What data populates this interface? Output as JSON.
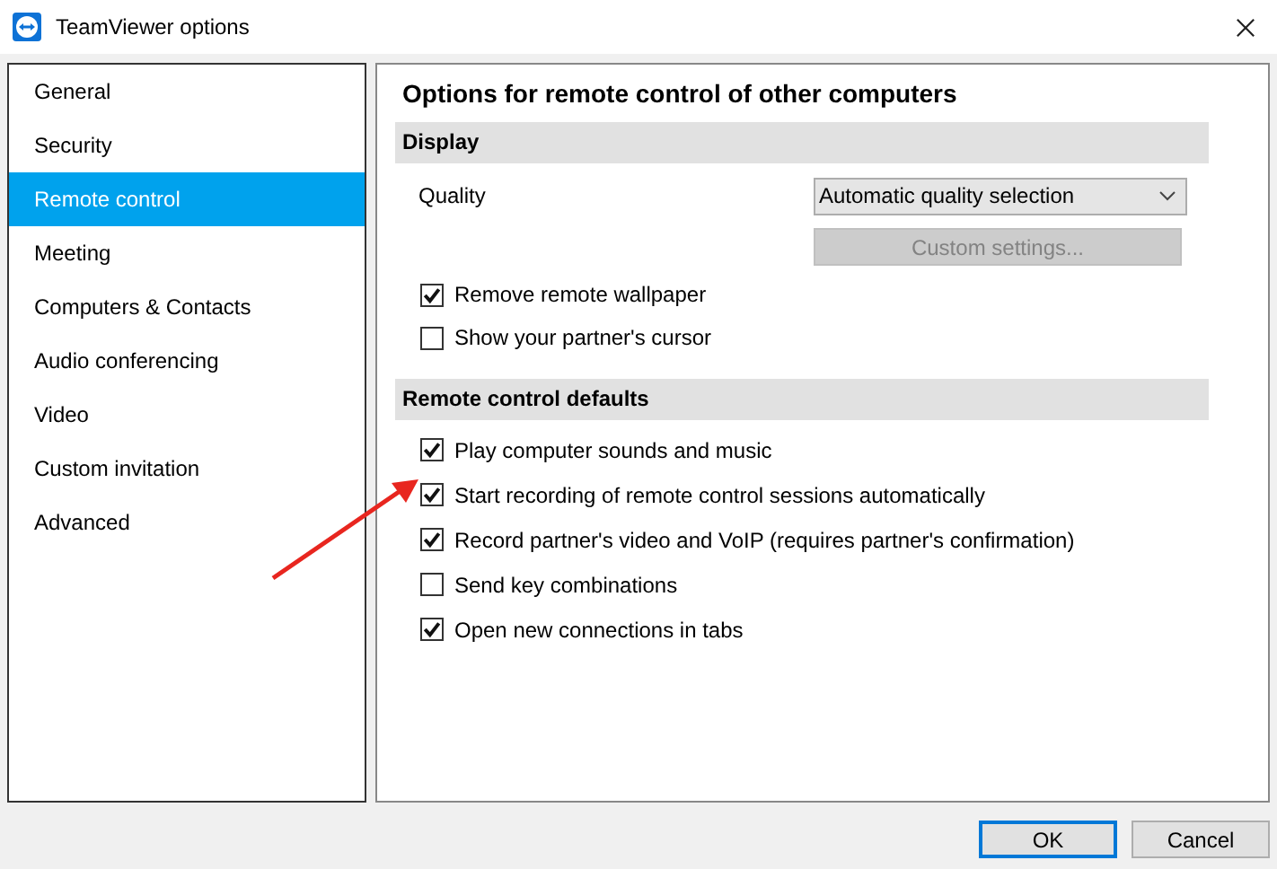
{
  "window": {
    "title": "TeamViewer options"
  },
  "sidebar": {
    "items": [
      {
        "label": "General",
        "selected": false
      },
      {
        "label": "Security",
        "selected": false
      },
      {
        "label": "Remote control",
        "selected": true
      },
      {
        "label": "Meeting",
        "selected": false
      },
      {
        "label": "Computers & Contacts",
        "selected": false
      },
      {
        "label": "Audio conferencing",
        "selected": false
      },
      {
        "label": "Video",
        "selected": false
      },
      {
        "label": "Custom invitation",
        "selected": false
      },
      {
        "label": "Advanced",
        "selected": false
      }
    ]
  },
  "main": {
    "heading": "Options for remote control of other computers",
    "display": {
      "title": "Display",
      "quality_label": "Quality",
      "quality_value": "Automatic quality selection",
      "custom_button": {
        "label": "Custom settings...",
        "disabled": true
      },
      "options": [
        {
          "label": "Remove remote wallpaper",
          "checked": true
        },
        {
          "label": "Show your partner's cursor",
          "checked": false
        }
      ]
    },
    "defaults": {
      "title": "Remote control defaults",
      "options": [
        {
          "label": "Play computer sounds and music",
          "checked": true
        },
        {
          "label": "Start recording of remote control sessions automatically",
          "checked": true
        },
        {
          "label": "Record partner's video and VoIP (requires partner's confirmation)",
          "checked": true
        },
        {
          "label": "Send key combinations",
          "checked": false
        },
        {
          "label": "Open new connections in tabs",
          "checked": true
        }
      ]
    }
  },
  "buttons": [
    {
      "label": "OK",
      "default": true
    },
    {
      "label": "Cancel",
      "default": false
    }
  ]
}
